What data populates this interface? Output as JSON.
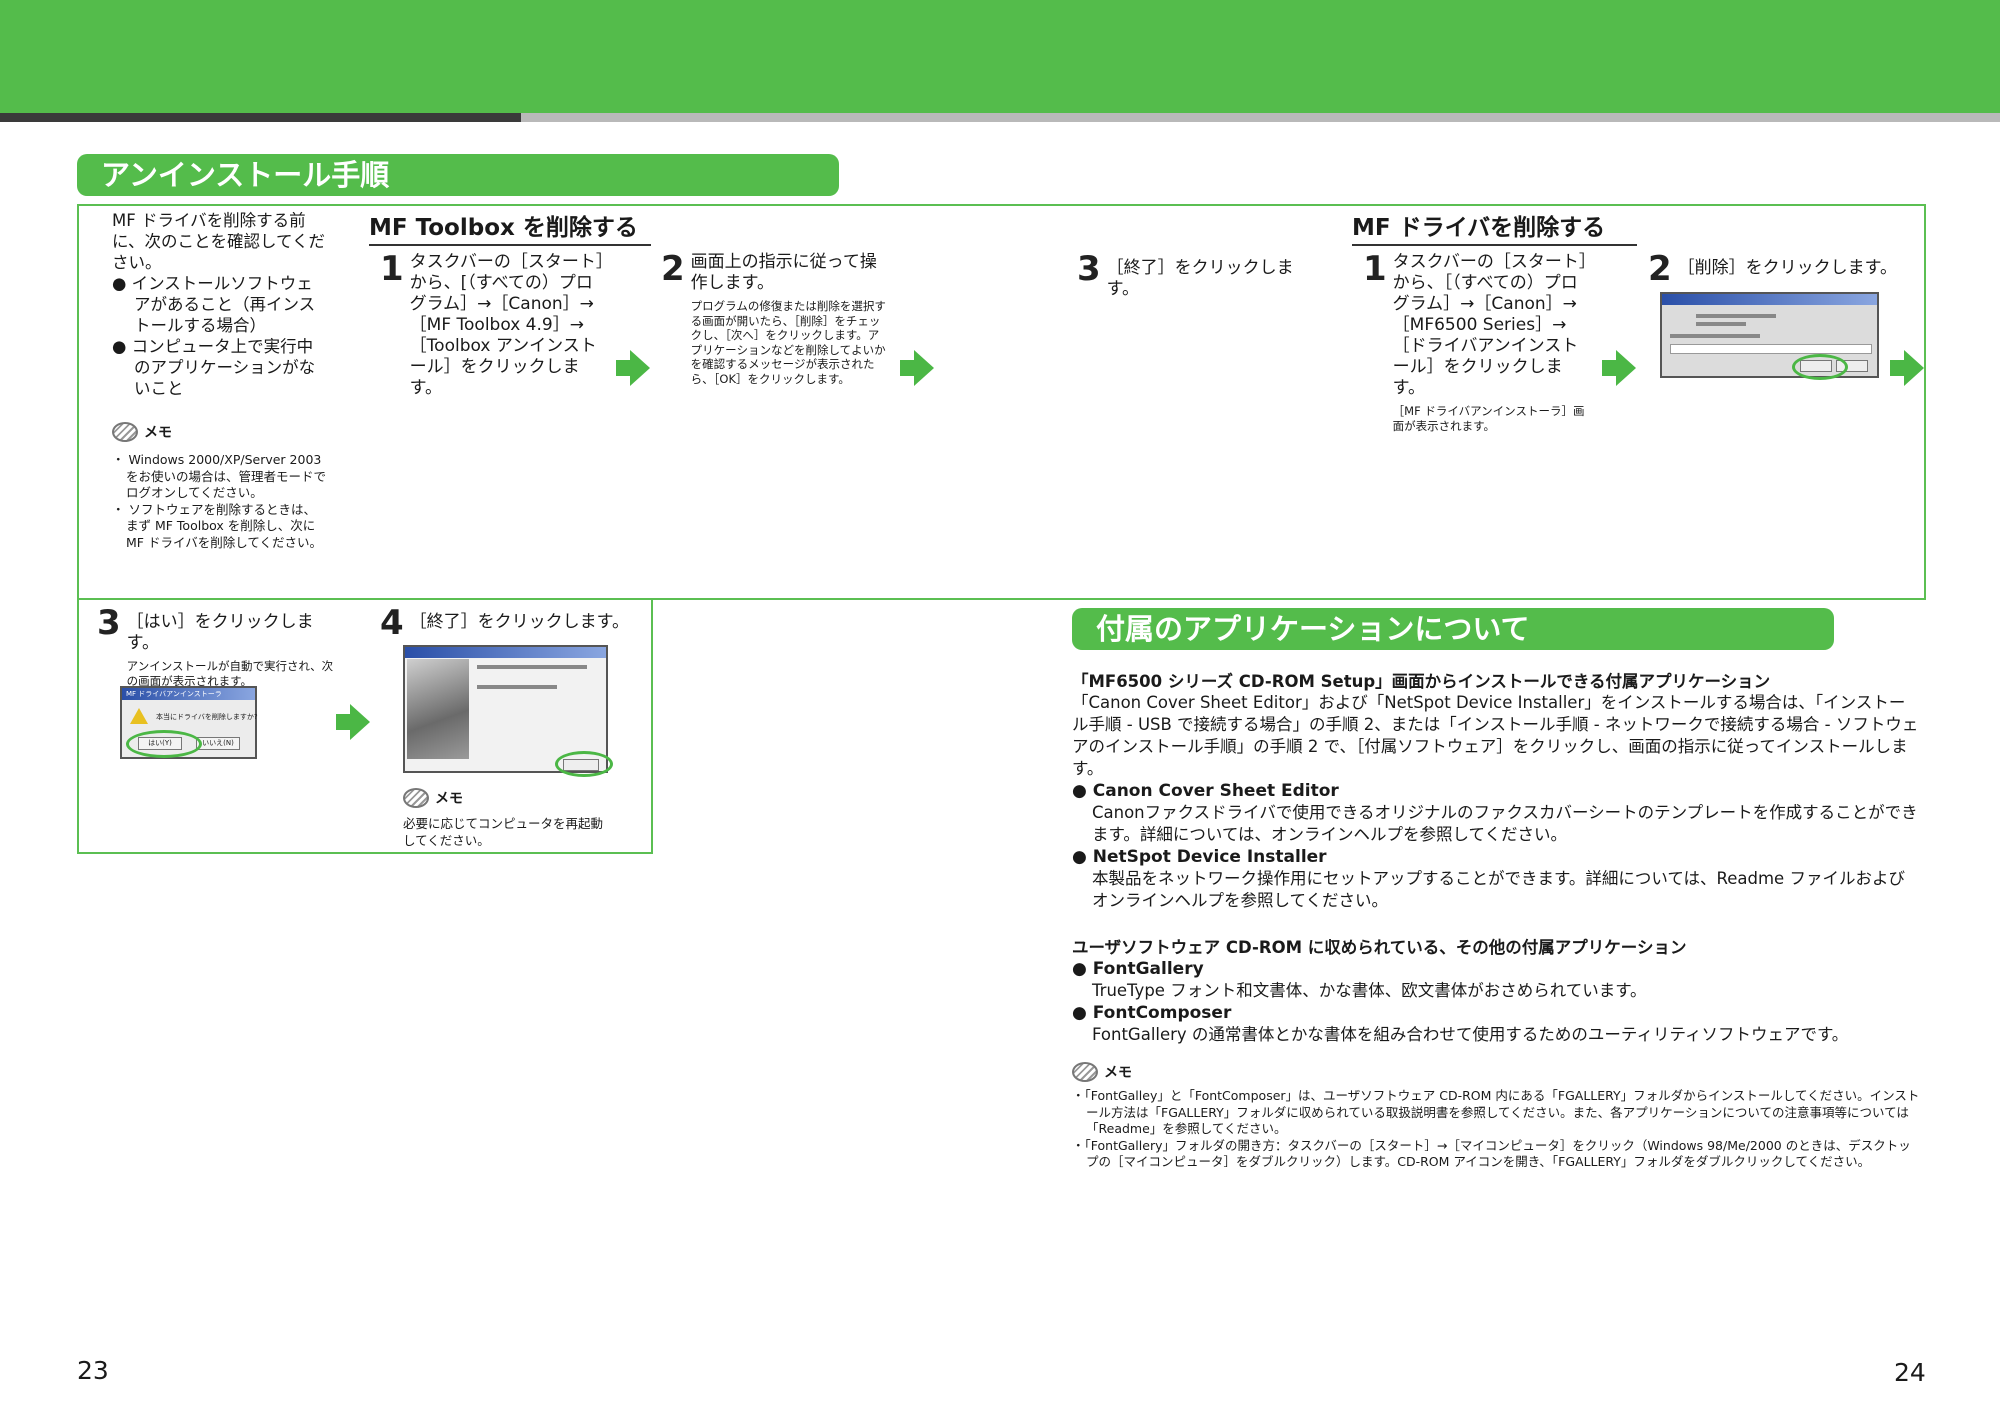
{
  "header": {
    "accent": "#54bc4b"
  },
  "uninstall": {
    "title": "アンインストール手順",
    "intro": {
      "lead": "MF ドライバを削除する前に、次のことを確認してください。",
      "bullets": [
        "● インストールソフトウェアがあること（再インストールする場合）",
        "● コンピュータ上で実行中のアプリケーションがないこと"
      ],
      "memo_label": "メモ",
      "memo_items": [
        "・ Windows 2000/XP/Server 2003 をお使いの場合は、管理者モードでログオンしてください。",
        "・ ソフトウェアを削除するときは、まず MF Toolbox を削除し、次に MF ドライバを削除してください。"
      ]
    },
    "toolbox": {
      "heading": "MF Toolbox を削除する",
      "step1": {
        "num": "1",
        "text": "タスクバーの［スタート］から、[（すべての）プログラム］→［Canon］→［MF Toolbox 4.9］→［Toolbox アンインストール］をクリックします。"
      },
      "step2": {
        "num": "2",
        "text": "画面上の指示に従って操作します。",
        "note": "プログラムの修復または削除を選択する画面が開いたら、［削除］をチェックし、［次へ］をクリックします。アプリケーションなどを削除してよいかを確認するメッセージが表示されたら、［OK］をクリックします。"
      },
      "step3": {
        "num": "3",
        "text": "［終了］をクリックします。"
      }
    },
    "driver": {
      "heading": "MF ドライバを削除する",
      "step1": {
        "num": "1",
        "text": "タスクバーの［スタート］から、［（すべての）プログラム］→［Canon］→［MF6500 Series］→［ドライバアンインストール］をクリックします。",
        "note": "［MF ドライバアンインストーラ］画面が表示されます。"
      },
      "step2": {
        "num": "2",
        "text": "［削除］をクリックします。"
      },
      "step3": {
        "num": "3",
        "text": "［はい］をクリックします。",
        "note": "アンインストールが自動で実行され、次の画面が表示されます。"
      },
      "step4": {
        "num": "4",
        "text": "［終了］をクリックします。"
      },
      "memo_label": "メモ",
      "memo_text": "必要に応じてコンピュータを再起動してください。"
    },
    "dialog_title": "MF ドライバアンインストーラ",
    "dialog_msg": "本当にドライバを削除しますか?",
    "dialog_yes": "はい(Y)",
    "dialog_no": "いいえ(N)"
  },
  "apps": {
    "title": "付属のアプリケーションについて",
    "h1": "「MF6500 シリーズ CD-ROM Setup」画面からインストールできる付属アプリケーション",
    "p1": "「Canon Cover Sheet Editor」および「NetSpot Device Installer」をインストールする場合は、「インストール手順 - USB で接続する場合」の手順 2、または「インストール手順 - ネットワークで接続する場合 - ソフトウェアのインストール手順」の手順 2 で、［付属ソフトウェア］をクリックし、画面の指示に従ってインストールします。",
    "items1": [
      {
        "name": "● Canon Cover Sheet Editor",
        "desc": "Canonファクスドライバで使用できるオリジナルのファクスカバーシートのテンプレートを作成することができます。詳細については、オンラインヘルプを参照してください。"
      },
      {
        "name": "● NetSpot Device Installer",
        "desc": "本製品をネットワーク操作用にセットアップすることができます。詳細については、Readme ファイルおよびオンラインヘルプを参照してください。"
      }
    ],
    "h2": "ユーザソフトウェア CD-ROM に収められている、その他の付属アプリケーション",
    "items2": [
      {
        "name": "● FontGallery",
        "desc": "TrueType フォント和文書体、かな書体、欧文書体がおさめられています。"
      },
      {
        "name": "● FontComposer",
        "desc": "FontGallery の通常書体とかな書体を組み合わせて使用するためのユーティリティソフトウェアです。"
      }
    ],
    "memo_label": "メモ",
    "memo_items": [
      "・「FontGalley」と「FontComposer」は、ユーザソフトウェア CD-ROM 内にある「FGALLERY」フォルダからインストールしてください。インストール方法は「FGALLERY」フォルダに収められている取扱説明書を参照してください。また、各アプリケーションについての注意事項等については「Readme」を参照してください。",
      "・「FontGallery」フォルダの開き方：タスクバーの［スタート］→［マイコンピュータ］をクリック（Windows 98/Me/2000 のときは、デスクトップの［マイコンピュータ］をダブルクリック）します。CD-ROM アイコンを開き、「FGALLERY」フォルダをダブルクリックしてください。"
    ]
  },
  "page_left": "23",
  "page_right": "24"
}
